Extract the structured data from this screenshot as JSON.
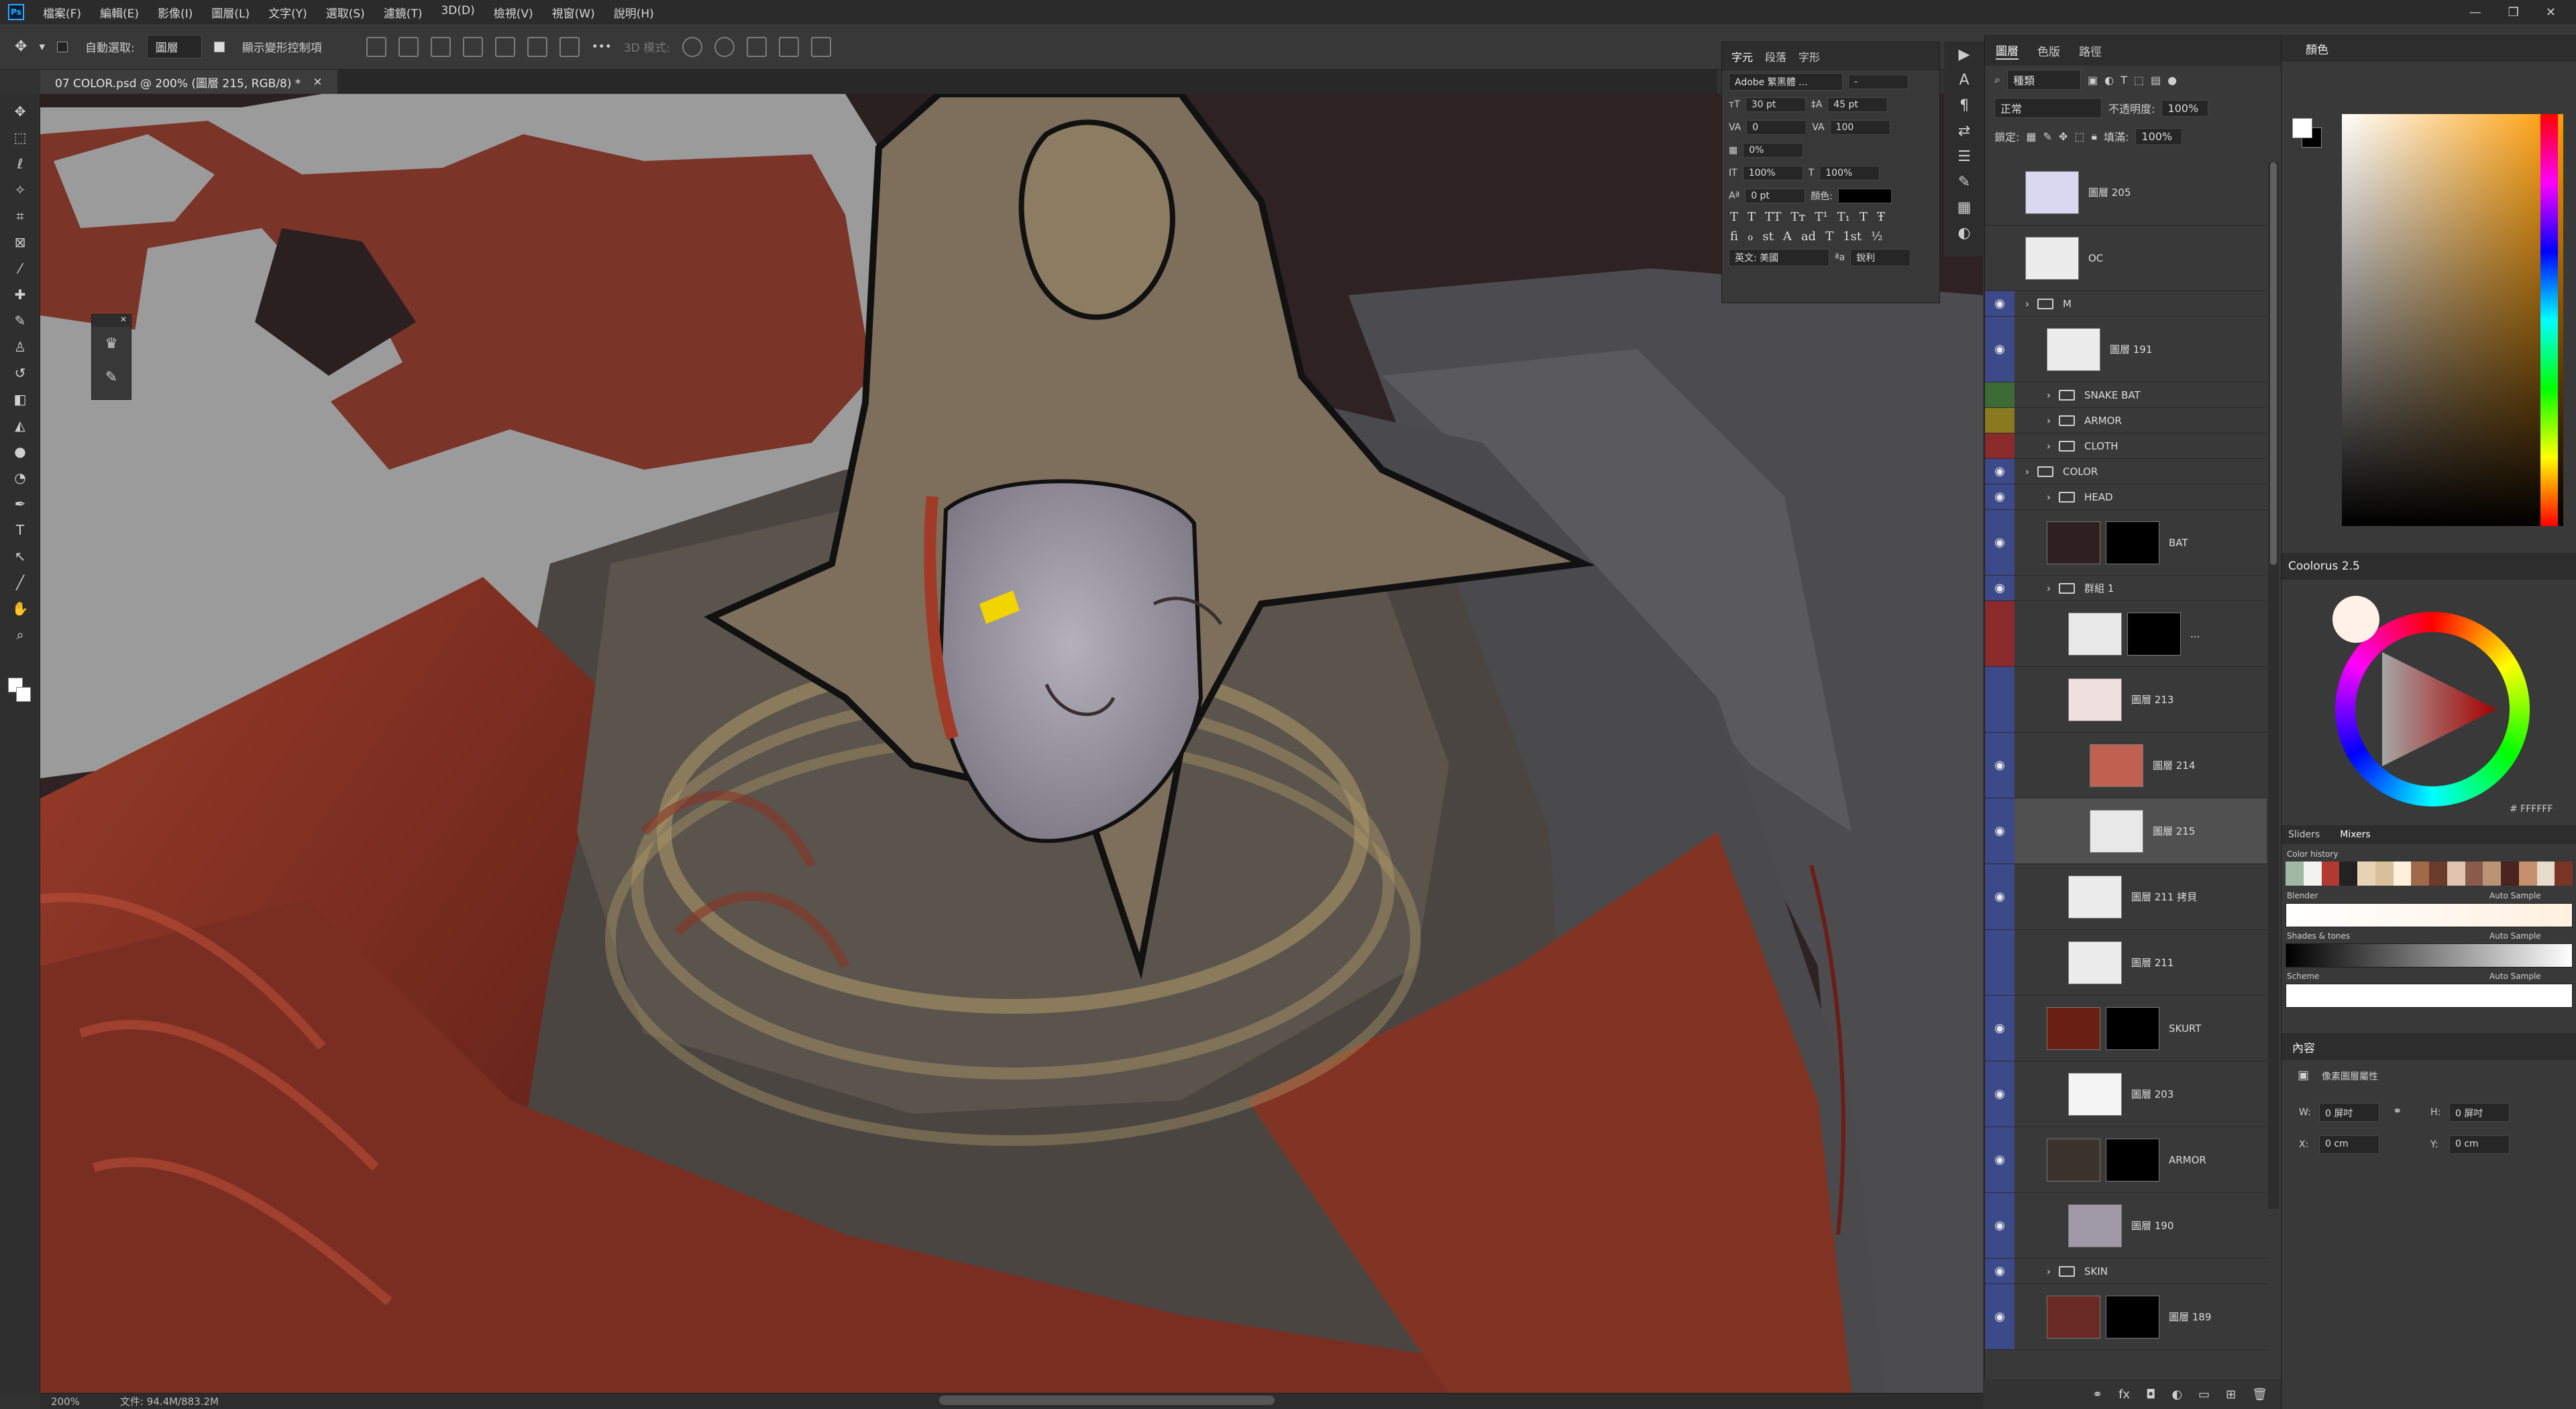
{
  "app": {
    "logo": "Ps",
    "menu": [
      "檔案(F)",
      "編輯(E)",
      "影像(I)",
      "圖層(L)",
      "文字(Y)",
      "選取(S)",
      "濾鏡(T)",
      "3D(D)",
      "檢視(V)",
      "視窗(W)",
      "說明(H)"
    ],
    "window_controls": [
      "—",
      "❐",
      "✕"
    ]
  },
  "options_bar": {
    "auto_select_label": "自動選取:",
    "auto_select_target": "圖層",
    "show_transform_label": "顯示變形控制項",
    "more": "•••",
    "mode_3d": "3D 模式:"
  },
  "document": {
    "tab_title": "07 COLOR.psd @ 200% (圖層 215, RGB/8) *",
    "close": "×",
    "zoom": "200%",
    "file_info": "文件: 94.4M/883.2M"
  },
  "tools": [
    "move-tool",
    "marquee-tool",
    "lasso-tool",
    "magic-wand-tool",
    "crop-tool",
    "frame-tool",
    "eyedropper-tool",
    "healing-tool",
    "brush-tool",
    "stamp-tool",
    "history-brush-tool",
    "eraser-tool",
    "bucket-tool",
    "blur-tool",
    "dodge-tool",
    "pen-tool",
    "type-tool",
    "path-select-tool",
    "line-tool",
    "hand-tool",
    "zoom-tool"
  ],
  "character_panel": {
    "tabs": [
      "字元",
      "段落",
      "字形"
    ],
    "font_family": "Adobe 繁黑體 ...",
    "font_style": "-",
    "size": "30 pt",
    "leading": "45 pt",
    "kerning": "0",
    "tracking": "100",
    "tsume": "0%",
    "vscale": "100%",
    "hscale": "100%",
    "baseline": "0 pt",
    "color_label": "顏色:",
    "language": "英文: 美國",
    "aa_label": "ªa",
    "aa_mode": "銳利",
    "glyphs_row1": [
      "T",
      "T",
      "TT",
      "Tт",
      "T¹",
      "T₁",
      "T",
      "Ŧ"
    ],
    "glyphs_row2": [
      "fi",
      "ℴ",
      "st",
      "A",
      "ad",
      "T",
      "1st",
      "½"
    ]
  },
  "layers_panel": {
    "tabs": [
      "圖層",
      "色版",
      "路徑"
    ],
    "filter_kind": "種類",
    "blend_mode": "正常",
    "opacity_label": "不透明度:",
    "opacity": "100%",
    "lock_label": "鎖定:",
    "fill_label": "填滿:",
    "fill": "100%",
    "layers": [
      {
        "name": "圖層 205",
        "type": "layer",
        "indent": 0,
        "visible": false,
        "tag": "#393939",
        "thumb": "#d8d8f0"
      },
      {
        "name": "OC",
        "type": "layer",
        "indent": 0,
        "visible": false,
        "tag": "#393939",
        "thumb": "#ececec"
      },
      {
        "name": "M",
        "type": "group",
        "indent": 0,
        "visible": true,
        "tag": "#3d4a8a"
      },
      {
        "name": "圖層 191",
        "type": "layer",
        "indent": 1,
        "visible": true,
        "tag": "#3d4a8a",
        "thumb": "#ececec"
      },
      {
        "name": "SNAKE BAT",
        "type": "group",
        "indent": 1,
        "visible": false,
        "tag": "#3d6b35"
      },
      {
        "name": "ARMOR",
        "type": "group",
        "indent": 1,
        "visible": false,
        "tag": "#8a7a1f"
      },
      {
        "name": "CLOTH",
        "type": "group",
        "indent": 1,
        "visible": false,
        "tag": "#8a2a2a",
        "thumb": "#ffffff"
      },
      {
        "name": "COLOR",
        "type": "group",
        "indent": 0,
        "visible": true,
        "tag": "#3d4a8a"
      },
      {
        "name": "HEAD",
        "type": "group",
        "indent": 1,
        "visible": true,
        "tag": "#3d4a8a"
      },
      {
        "name": "BAT",
        "type": "layer",
        "indent": 1,
        "visible": true,
        "tag": "#3d4a8a",
        "thumb": "#2e2020",
        "mask": true
      },
      {
        "name": "群組 1",
        "type": "group",
        "indent": 1,
        "visible": true,
        "tag": "#3d4a8a"
      },
      {
        "name": "...",
        "type": "layer",
        "indent": 2,
        "visible": false,
        "tag": "#8a2a2a",
        "thumb": "#e8e8e8",
        "mask": true
      },
      {
        "name": "圖層 213",
        "type": "layer",
        "indent": 2,
        "visible": false,
        "tag": "#3d4a8a",
        "thumb": "#f0e0e0"
      },
      {
        "name": "圖層 214",
        "type": "layer",
        "indent": 3,
        "visible": true,
        "tag": "#3d4a8a",
        "thumb": "#c06050"
      },
      {
        "name": "圖層 215",
        "type": "layer",
        "indent": 3,
        "visible": true,
        "tag": "#3d4a8a",
        "thumb": "#e8e8e8",
        "selected": true
      },
      {
        "name": "圖層 211 拷貝",
        "type": "layer",
        "indent": 2,
        "visible": true,
        "tag": "#3d4a8a",
        "thumb": "#ececec"
      },
      {
        "name": "圖層 211",
        "type": "layer",
        "indent": 2,
        "visible": false,
        "tag": "#3d4a8a",
        "thumb": "#ececec"
      },
      {
        "name": "SKURT",
        "type": "layer",
        "indent": 1,
        "visible": true,
        "tag": "#3d4a8a",
        "thumb": "#6a1f14",
        "mask": true
      },
      {
        "name": "圖層 203",
        "type": "layer",
        "indent": 2,
        "visible": true,
        "tag": "#3d4a8a",
        "thumb": "#f4f4f4"
      },
      {
        "name": "ARMOR",
        "type": "layer",
        "indent": 1,
        "visible": true,
        "tag": "#3d4a8a",
        "thumb": "#3a342c",
        "mask": true
      },
      {
        "name": "圖層 190",
        "type": "layer",
        "indent": 2,
        "visible": true,
        "tag": "#3d4a8a",
        "thumb": "#a09aa8"
      },
      {
        "name": "SKIN",
        "type": "group",
        "indent": 1,
        "visible": true,
        "tag": "#3d4a8a"
      },
      {
        "name": "圖層 189",
        "type": "layer",
        "indent": 1,
        "visible": true,
        "tag": "#3d4a8a",
        "thumb": "#6a2a24",
        "mask": true
      }
    ],
    "bottom_icons": [
      "link-icon",
      "fx-icon",
      "mask-icon",
      "adjustment-icon",
      "folder-icon",
      "new-layer-icon",
      "trash-icon"
    ]
  },
  "color_panel": {
    "title": "顏色",
    "foreground": "#ffffff",
    "background": "#000000"
  },
  "coolorus": {
    "title": "Coolorus 2.5",
    "hex": "# FFFFFF",
    "tabs": [
      "Sliders",
      "Mixers"
    ],
    "color_history": "Color history",
    "blender": "Blender",
    "shades": "Shades & tones",
    "scheme": "Scheme",
    "auto_sample": "Auto Sample",
    "history_colors": [
      "#9fb9a5",
      "#f2f2ee",
      "#b03a30",
      "#222222",
      "#e8d4b4",
      "#d8c09a",
      "#fff1dc",
      "#a06a4a",
      "#6a3a2a",
      "#e0c4b0",
      "#8a5a4a",
      "#b89474",
      "#4a2420",
      "#c4906c",
      "#e6dccc",
      "#7a3424"
    ]
  },
  "properties_panel": {
    "title": "內容",
    "subtitle": "像素圖層屬性",
    "w_label": "W:",
    "w_val": "0 屏吋",
    "h_label": "H:",
    "h_val": "0 屏吋",
    "x_label": "X:",
    "x_val": "0 cm",
    "y_label": "Y:",
    "y_val": "0 cm"
  },
  "colors": {
    "accent": "#31a8ff",
    "red_robe": "#8a3424",
    "helmet": "#7a6c58",
    "gray_bg": "#9a9a9a"
  }
}
